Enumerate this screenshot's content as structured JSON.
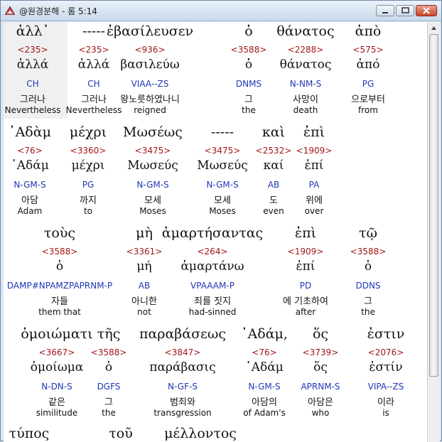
{
  "window": {
    "title": "@원경분해 - 롬 5:14"
  },
  "rows": [
    {
      "cols": [
        {
          "greek": "ἀλλ᾽",
          "strong": "<235>",
          "lemma": "ἀλλά",
          "parse": "CH",
          "korean": "그러나",
          "english": "Nevertheless"
        },
        {
          "greek": "-----",
          "strong": "<235>",
          "lemma": "ἀλλά",
          "parse": "CH",
          "korean": "그러나",
          "english": "Nevertheless"
        },
        {
          "greek": "ἐβασίλευσεν",
          "strong": "<936>",
          "lemma": "βασιλεύω",
          "parse": "VIAA--ZS",
          "korean": "왕노릇하였나니",
          "english": "reigned"
        },
        {
          "greek": "ὁ",
          "strong": "<3588>",
          "lemma": "ὁ",
          "parse": "DNMS",
          "korean": "그",
          "english": "the"
        },
        {
          "greek": "θάνατος",
          "strong": "<2288>",
          "lemma": "θάνατος",
          "parse": "N-NM-S",
          "korean": "사망이",
          "english": "death"
        },
        {
          "greek": "ἀπὸ",
          "strong": "<575>",
          "lemma": "ἀπό",
          "parse": "PG",
          "korean": "으로부터",
          "english": "from"
        }
      ]
    },
    {
      "cols": [
        {
          "greek": "᾽Αδὰμ",
          "strong": "<76>",
          "lemma": "᾽Αδάμ",
          "parse": "N-GM-S",
          "korean": "아담",
          "english": "Adam"
        },
        {
          "greek": "μέχρι",
          "strong": "<3360>",
          "lemma": "μέχρι",
          "parse": "PG",
          "korean": "까지",
          "english": "to"
        },
        {
          "greek": "Μωσέως",
          "strong": "<3475>",
          "lemma": "Μωσεύς",
          "parse": "N-GM-S",
          "korean": "모세",
          "english": "Moses"
        },
        {
          "greek": "-----",
          "strong": "<3475>",
          "lemma": "Μωσεύς",
          "parse": "N-GM-S",
          "korean": "모세",
          "english": "Moses"
        },
        {
          "greek": "καὶ",
          "strong": "<2532>",
          "lemma": "καί",
          "parse": "AB",
          "korean": "도",
          "english": "even"
        },
        {
          "greek": "ἐπὶ",
          "strong": "<1909>",
          "lemma": "ἐπί",
          "parse": "PA",
          "korean": "위에",
          "english": "over"
        }
      ]
    },
    {
      "cols": [
        {
          "greek": "τοὺς",
          "strong": "<3588>",
          "lemma": "ὁ",
          "parse": "DAMP#NPAMZPAPRNM-P",
          "korean": "자들",
          "english": "them that"
        },
        {
          "greek": "μὴ",
          "strong": "<3361>",
          "lemma": "μή",
          "parse": "AB",
          "korean": "아니한",
          "english": "not"
        },
        {
          "greek": "ἁμαρτήσαντας",
          "strong": "<264>",
          "lemma": "ἁμαρτάνω",
          "parse": "VPAAAM-P",
          "korean": "죄를 짓지",
          "english": "had-sinned"
        },
        {
          "greek": "ἐπὶ",
          "strong": "<1909>",
          "lemma": "ἐπί",
          "parse": "PD",
          "korean": "에 기초하여",
          "english": "after"
        },
        {
          "greek": "τῷ",
          "strong": "<3588>",
          "lemma": "ὁ",
          "parse": "DDNS",
          "korean": "그",
          "english": "the"
        }
      ]
    },
    {
      "cols": [
        {
          "greek": "ὁμοιώματι",
          "strong": "<3667>",
          "lemma": "ὁμοίωμα",
          "parse": "N-DN-S",
          "korean": "같은",
          "english": "similitude"
        },
        {
          "greek": "τῆς",
          "strong": "<3588>",
          "lemma": "ὁ",
          "parse": "DGFS",
          "korean": "그",
          "english": "the"
        },
        {
          "greek": "παραβάσεως",
          "strong": "<3847>",
          "lemma": "παράβασις",
          "parse": "N-GF-S",
          "korean": "범죄와",
          "english": "transgression"
        },
        {
          "greek": "᾽Αδάμ,",
          "strong": "<76>",
          "lemma": "᾽Αδάμ",
          "parse": "N-GM-S",
          "korean": "아담의",
          "english": "of Adam's"
        },
        {
          "greek": "ὅς",
          "strong": "<3739>",
          "lemma": "ὅς",
          "parse": "APRNM-S",
          "korean": "아담은",
          "english": "who"
        },
        {
          "greek": "ἐστιν",
          "strong": "<2076>",
          "lemma": "ἐστίν",
          "parse": "VIPA--ZS",
          "korean": "이라",
          "english": "is"
        }
      ]
    },
    {
      "cols": [
        {
          "greek": "τύπος"
        },
        {
          "greek": "τοῦ"
        },
        {
          "greek": "μέλλοντος"
        }
      ]
    }
  ]
}
